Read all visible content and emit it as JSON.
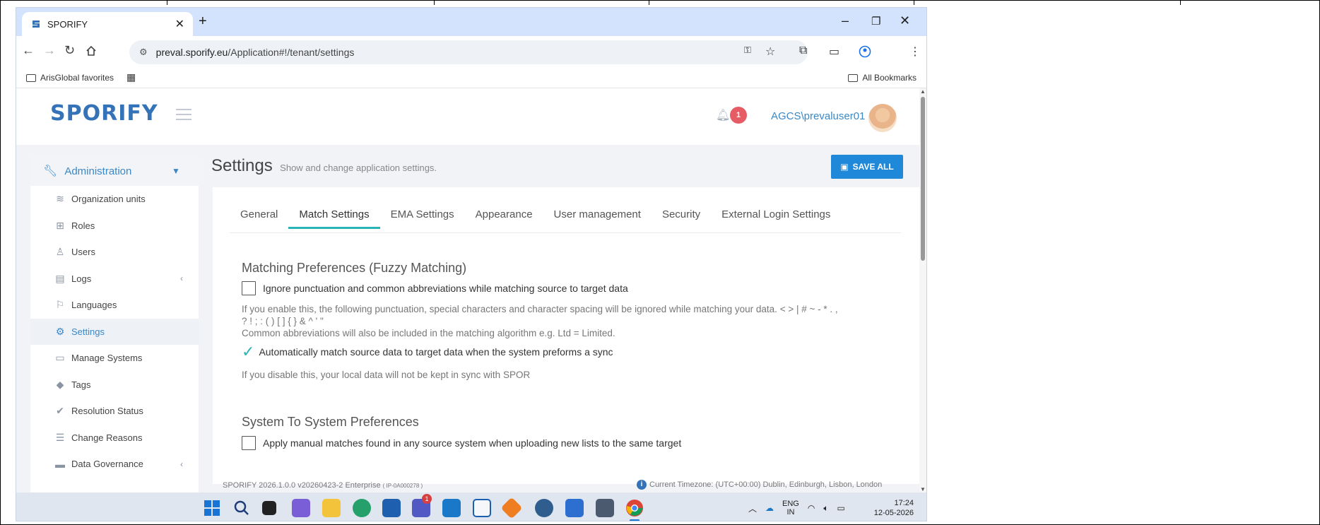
{
  "browser": {
    "tab_title": "SPORIFY",
    "url_host": "preval.sporify.eu",
    "url_path": "/Application#!/tenant/settings",
    "bookmarks": {
      "favorites": "ArisGlobal favorites",
      "all": "All Bookmarks"
    }
  },
  "header": {
    "logo": "SPORIFY",
    "notification_count": "1",
    "username": "AGCS\\prevaluser01"
  },
  "sidebar": {
    "section": "Administration",
    "items": [
      {
        "label": "Organization units",
        "icon": "layers-icon"
      },
      {
        "label": "Roles",
        "icon": "roles-icon"
      },
      {
        "label": "Users",
        "icon": "users-icon"
      },
      {
        "label": "Logs",
        "icon": "logs-icon"
      },
      {
        "label": "Languages",
        "icon": "flag-icon"
      },
      {
        "label": "Settings",
        "icon": "gear-icon"
      },
      {
        "label": "Manage Systems",
        "icon": "laptop-icon"
      },
      {
        "label": "Tags",
        "icon": "tags-icon"
      },
      {
        "label": "Resolution Status",
        "icon": "check-icon"
      },
      {
        "label": "Change Reasons",
        "icon": "list-icon"
      },
      {
        "label": "Data Governance",
        "icon": "governance-icon"
      }
    ]
  },
  "content": {
    "title": "Settings",
    "subtitle": "Show and change application settings.",
    "save_label": "SAVE ALL",
    "tabs": [
      "General",
      "Match Settings",
      "EMA Settings",
      "Appearance",
      "User management",
      "Security",
      "External Login Settings"
    ],
    "active_tab": "Match Settings",
    "matching": {
      "heading": "Matching Preferences (Fuzzy Matching)",
      "opt1_label": "Ignore punctuation and common abbreviations while matching source to target data",
      "opt1_help_a": "If you enable this, the following punctuation, special characters and character spacing will be ignored while matching your data. < > | # ~ - * . ,",
      "opt1_help_b": "? ! ; : ( ) [ ] { } & ^ ' \"",
      "opt1_help_c": "Common abbreviations will also be included in the matching algorithm e.g. Ltd = Limited.",
      "opt2_label": "Automatically match source data to target data when the system preforms a sync",
      "opt2_help": "If you disable this, your local data will not be kept in sync with SPOR"
    },
    "system": {
      "heading": "System To System Preferences",
      "opt1_label": "Apply manual matches found in any source system when uploading new lists to the same target"
    }
  },
  "footer": {
    "version": "SPORIFY 2026.1.0.0 v20260423-2 Enterprise",
    "build": "( IP-0A000278 )",
    "timezone": "Current Timezone: (UTC+00:00) Dublin, Edinburgh, Lisbon, London"
  },
  "taskbar": {
    "lang_top": "ENG",
    "lang_bottom": "IN",
    "time": "17:24",
    "date": "12-05-2026",
    "teams_badge": "1"
  },
  "colors": {
    "brand_blue": "#3573b9",
    "link_blue": "#3a88c8",
    "save_button": "#1f88d9",
    "tab_accent": "#2ab3b9",
    "notif_red": "#e55c64"
  }
}
